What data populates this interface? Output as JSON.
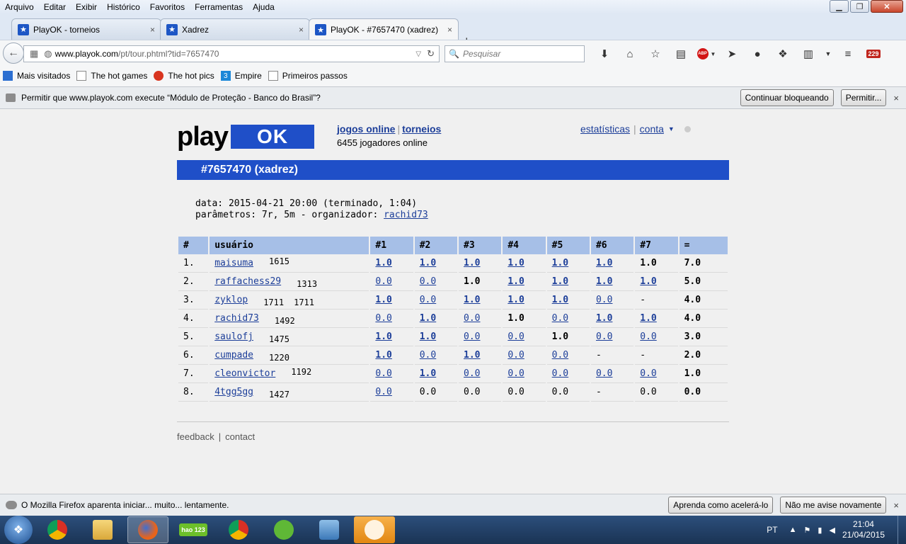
{
  "menubar": {
    "items": [
      {
        "label": "Arquivo"
      },
      {
        "label": "Editar"
      },
      {
        "label": "Exibir"
      },
      {
        "label": "Histórico"
      },
      {
        "label": "Favoritos"
      },
      {
        "label": "Ferramentas"
      },
      {
        "label": "Ajuda"
      }
    ]
  },
  "tabs": [
    {
      "title": "PlayOK - torneios",
      "close": "×"
    },
    {
      "title": "Xadrez",
      "close": "×"
    },
    {
      "title": "PlayOK - #7657470 (xadrez)",
      "close": "×"
    }
  ],
  "new_tab": "+",
  "navbar": {
    "url_host": "www.playok.com",
    "url_path": "/pt/tour.phtml?tid=7657470",
    "search_placeholder": "Pesquisar",
    "badge_count": "229"
  },
  "bookmarks": [
    {
      "label": "Mais visitados",
      "icon": "bookmarks-folder-icon"
    },
    {
      "label": "The hot games",
      "icon": "page-icon"
    },
    {
      "label": "The hot pics",
      "icon": "pin-icon"
    },
    {
      "label": "Empire",
      "icon": "empire-icon"
    },
    {
      "label": "Primeiros passos",
      "icon": "page-icon"
    }
  ],
  "plugin_notice": {
    "text": "Permitir que www.playok.com execute “Módulo de Proteção - Banco do Brasil”?",
    "continue_blocking": "Continuar bloqueando",
    "allow": "Permitir...",
    "close": "×"
  },
  "site": {
    "logo_play": "play",
    "logo_ok": "OK",
    "nav_games": "jogos online",
    "nav_tournaments": "torneios",
    "online_count": "6455",
    "online_text": "jogadores online",
    "nav_stats": "estatísticas",
    "nav_account": "conta",
    "caret": "▼",
    "tournament_title": "#7657470 (xadrez)",
    "date_line": "data: 2015-04-21 20:00 (terminado, 1:04)",
    "params_prefix": "parâmetros: 7r, 5m - organizador:",
    "organizer": "rachid73",
    "footer_feedback": "feedback",
    "footer_sep": "|",
    "footer_contact": "contact"
  },
  "table": {
    "headers": [
      "#",
      "usuário",
      "#1",
      "#2",
      "#3",
      "#4",
      "#5",
      "#6",
      "#7",
      "="
    ],
    "rows": [
      {
        "rank": "1.",
        "user": "maisuma",
        "rating": "1615",
        "rating_pos": "high",
        "extra": "",
        "rounds": [
          {
            "v": "1.0",
            "link": true,
            "win": true
          },
          {
            "v": "1.0",
            "link": true,
            "win": true
          },
          {
            "v": "1.0",
            "link": true,
            "win": true
          },
          {
            "v": "1.0",
            "link": true,
            "win": true
          },
          {
            "v": "1.0",
            "link": true,
            "win": true
          },
          {
            "v": "1.0",
            "link": true,
            "win": true
          },
          {
            "v": "1.0",
            "link": false,
            "win": true
          }
        ],
        "total": "7.0"
      },
      {
        "rank": "2.",
        "user": "raffachess29",
        "rating": "1313",
        "rating_pos": "low",
        "extra": "",
        "rounds": [
          {
            "v": "0.0",
            "link": true,
            "win": false
          },
          {
            "v": "0.0",
            "link": true,
            "win": false
          },
          {
            "v": "1.0",
            "link": false,
            "win": true
          },
          {
            "v": "1.0",
            "link": true,
            "win": true
          },
          {
            "v": "1.0",
            "link": true,
            "win": true
          },
          {
            "v": "1.0",
            "link": true,
            "win": true
          },
          {
            "v": "1.0",
            "link": true,
            "win": true
          }
        ],
        "total": "5.0"
      },
      {
        "rank": "3.",
        "user": "zyklop",
        "rating": "1711",
        "rating_pos": "low",
        "extra": "1711",
        "rounds": [
          {
            "v": "1.0",
            "link": true,
            "win": true
          },
          {
            "v": "0.0",
            "link": true,
            "win": false
          },
          {
            "v": "1.0",
            "link": true,
            "win": true
          },
          {
            "v": "1.0",
            "link": true,
            "win": true
          },
          {
            "v": "1.0",
            "link": true,
            "win": true
          },
          {
            "v": "0.0",
            "link": true,
            "win": false
          },
          {
            "v": "-",
            "link": false,
            "win": false
          }
        ],
        "total": "4.0"
      },
      {
        "rank": "4.",
        "user": "rachid73",
        "rating": "1492",
        "rating_pos": "low",
        "extra": "",
        "rounds": [
          {
            "v": "0.0",
            "link": true,
            "win": false
          },
          {
            "v": "1.0",
            "link": true,
            "win": true
          },
          {
            "v": "0.0",
            "link": true,
            "win": false
          },
          {
            "v": "1.0",
            "link": false,
            "win": true
          },
          {
            "v": "0.0",
            "link": true,
            "win": false
          },
          {
            "v": "1.0",
            "link": true,
            "win": true
          },
          {
            "v": "1.0",
            "link": true,
            "win": true
          }
        ],
        "total": "4.0"
      },
      {
        "rank": "5.",
        "user": "saulofj",
        "rating": "1475",
        "rating_pos": "low",
        "extra": "",
        "rounds": [
          {
            "v": "1.0",
            "link": true,
            "win": true
          },
          {
            "v": "1.0",
            "link": true,
            "win": true
          },
          {
            "v": "0.0",
            "link": true,
            "win": false
          },
          {
            "v": "0.0",
            "link": true,
            "win": false
          },
          {
            "v": "1.0",
            "link": false,
            "win": true
          },
          {
            "v": "0.0",
            "link": true,
            "win": false
          },
          {
            "v": "0.0",
            "link": true,
            "win": false
          }
        ],
        "total": "3.0"
      },
      {
        "rank": "6.",
        "user": "cumpade",
        "rating": "1220",
        "rating_pos": "low",
        "extra": "",
        "rounds": [
          {
            "v": "1.0",
            "link": true,
            "win": true
          },
          {
            "v": "0.0",
            "link": true,
            "win": false
          },
          {
            "v": "1.0",
            "link": true,
            "win": true
          },
          {
            "v": "0.0",
            "link": true,
            "win": false
          },
          {
            "v": "0.0",
            "link": true,
            "win": false
          },
          {
            "v": "-",
            "link": false,
            "win": false
          },
          {
            "v": "-",
            "link": false,
            "win": false
          }
        ],
        "total": "2.0"
      },
      {
        "rank": "7.",
        "user": "cleonvictor",
        "rating": "1192",
        "rating_pos": "high",
        "extra": "",
        "rounds": [
          {
            "v": "0.0",
            "link": true,
            "win": false
          },
          {
            "v": "1.0",
            "link": true,
            "win": true
          },
          {
            "v": "0.0",
            "link": true,
            "win": false
          },
          {
            "v": "0.0",
            "link": true,
            "win": false
          },
          {
            "v": "0.0",
            "link": true,
            "win": false
          },
          {
            "v": "0.0",
            "link": true,
            "win": false
          },
          {
            "v": "0.0",
            "link": true,
            "win": false
          }
        ],
        "total": "1.0"
      },
      {
        "rank": "8.",
        "user": "4tgg5gg",
        "rating": "1427",
        "rating_pos": "low",
        "extra": "",
        "rounds": [
          {
            "v": "0.0",
            "link": true,
            "win": false
          },
          {
            "v": "0.0",
            "link": false,
            "win": false
          },
          {
            "v": "0.0",
            "link": false,
            "win": false
          },
          {
            "v": "0.0",
            "link": false,
            "win": false
          },
          {
            "v": "0.0",
            "link": false,
            "win": false
          },
          {
            "v": "-",
            "link": false,
            "win": false
          },
          {
            "v": "0.0",
            "link": false,
            "win": false
          }
        ],
        "total": "0.0"
      }
    ]
  },
  "slow_notice": {
    "text": "O Mozilla Firefox aparenta iniciar... muito... lentamente.",
    "learn": "Aprenda como acelerá-lo",
    "dismiss": "Não me avise novamente",
    "close": "×"
  },
  "taskbar": {
    "apps": [
      "chrome-icon",
      "file-explorer-icon",
      "firefox-icon",
      "hao123-icon",
      "chrome-icon",
      "utorrent-icon",
      "network-icon",
      "avast-icon"
    ],
    "hao123": "hao 123",
    "language": "PT",
    "time": "21:04",
    "date": "21/04/2015"
  }
}
